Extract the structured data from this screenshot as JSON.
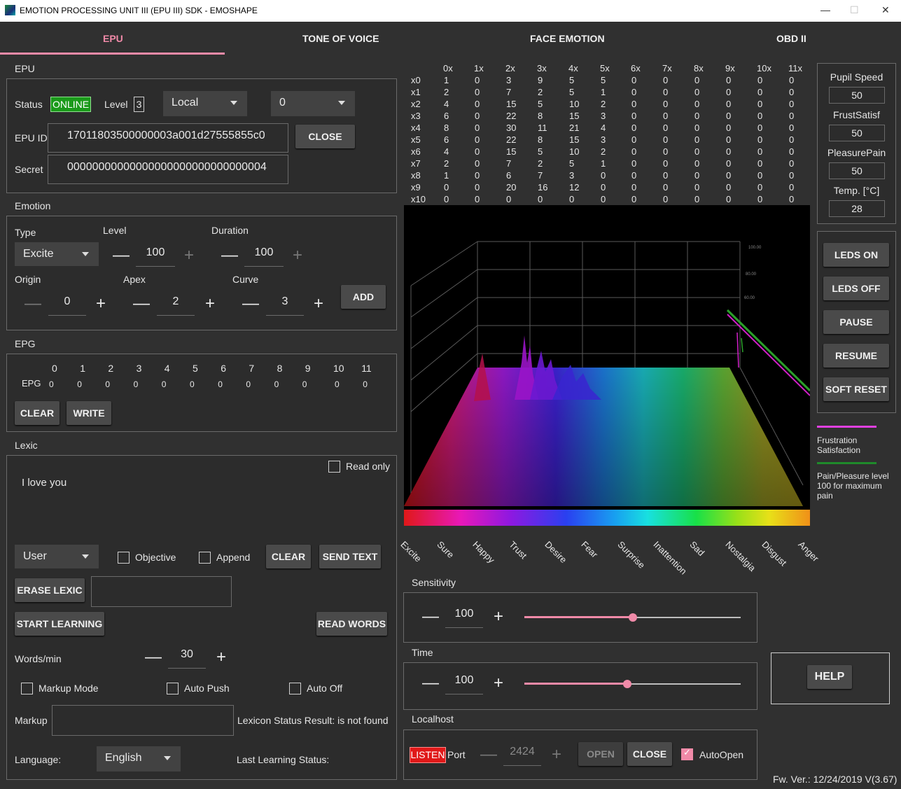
{
  "window": {
    "title": "EMOTION PROCESSING UNIT III (EPU III) SDK - EMOSHAPE",
    "min": "—",
    "max": "☐",
    "close": "✕"
  },
  "tabs": [
    "EPU",
    "TONE OF VOICE",
    "FACE EMOTION",
    "OBD II"
  ],
  "epu": {
    "section": "EPU",
    "status_label": "Status",
    "status_value": "ONLINE",
    "level_label": "Level",
    "level_value": "3",
    "mode": "Local",
    "channel": "0",
    "id_label": "EPU ID",
    "id_value": "17011803500000003a001d27555855c0",
    "close_label": "CLOSE",
    "secret_label": "Secret",
    "secret_value": "00000000000000000000000000000004"
  },
  "emotion": {
    "section": "Emotion",
    "type_label": "Type",
    "type_value": "Excite",
    "level_label": "Level",
    "level_value": "100",
    "duration_label": "Duration",
    "duration_value": "100",
    "origin_label": "Origin",
    "origin_value": "0",
    "apex_label": "Apex",
    "apex_value": "2",
    "curve_label": "Curve",
    "curve_value": "3",
    "add_label": "ADD",
    "minus": "—",
    "plus": "+"
  },
  "epg": {
    "section": "EPG",
    "row_label": "EPG",
    "headers": [
      "0",
      "1",
      "2",
      "3",
      "4",
      "5",
      "6",
      "7",
      "8",
      "9",
      "10",
      "11"
    ],
    "values": [
      "0",
      "0",
      "0",
      "0",
      "0",
      "0",
      "0",
      "0",
      "0",
      "0",
      "0",
      "0"
    ],
    "clear_label": "CLEAR",
    "write_label": "WRITE"
  },
  "lexic": {
    "section": "Lexic",
    "readonly_label": "Read only",
    "text": "I love you",
    "user_value": "User",
    "objective_label": "Objective",
    "append_label": "Append",
    "clear_label": "CLEAR",
    "send_label": "SEND TEXT",
    "erase_label": "ERASE LEXIC",
    "learn_label": "START LEARNING",
    "read_label": "READ WORDS",
    "wpm_label": "Words/min",
    "wpm_value": "30",
    "markup_mode_label": "Markup Mode",
    "auto_push_label": "Auto Push",
    "auto_off_label": "Auto Off",
    "markup_label": "Markup",
    "lexicon_status": "Lexicon Status Result: is not found",
    "language_label": "Language:",
    "language_value": "English",
    "last_status": "Last Learning Status:"
  },
  "matrix": {
    "cols": [
      "0x",
      "1x",
      "2x",
      "3x",
      "4x",
      "5x",
      "6x",
      "7x",
      "8x",
      "9x",
      "10x",
      "11x"
    ],
    "rows": [
      {
        "label": "x0",
        "values": [
          "1",
          "0",
          "3",
          "9",
          "5",
          "5",
          "0",
          "0",
          "0",
          "0",
          "0",
          "0"
        ]
      },
      {
        "label": "x1",
        "values": [
          "2",
          "0",
          "7",
          "2",
          "5",
          "1",
          "0",
          "0",
          "0",
          "0",
          "0",
          "0"
        ]
      },
      {
        "label": "x2",
        "values": [
          "4",
          "0",
          "15",
          "5",
          "10",
          "2",
          "0",
          "0",
          "0",
          "0",
          "0",
          "0"
        ]
      },
      {
        "label": "x3",
        "values": [
          "6",
          "0",
          "22",
          "8",
          "15",
          "3",
          "0",
          "0",
          "0",
          "0",
          "0",
          "0"
        ]
      },
      {
        "label": "x4",
        "values": [
          "8",
          "0",
          "30",
          "11",
          "21",
          "4",
          "0",
          "0",
          "0",
          "0",
          "0",
          "0"
        ]
      },
      {
        "label": "x5",
        "values": [
          "6",
          "0",
          "22",
          "8",
          "15",
          "3",
          "0",
          "0",
          "0",
          "0",
          "0",
          "0"
        ]
      },
      {
        "label": "x6",
        "values": [
          "4",
          "0",
          "15",
          "5",
          "10",
          "2",
          "0",
          "0",
          "0",
          "0",
          "0",
          "0"
        ]
      },
      {
        "label": "x7",
        "values": [
          "2",
          "0",
          "7",
          "2",
          "5",
          "1",
          "0",
          "0",
          "0",
          "0",
          "0",
          "0"
        ]
      },
      {
        "label": "x8",
        "values": [
          "1",
          "0",
          "6",
          "7",
          "3",
          "0",
          "0",
          "0",
          "0",
          "0",
          "0",
          "0"
        ]
      },
      {
        "label": "x9",
        "values": [
          "0",
          "0",
          "20",
          "16",
          "12",
          "0",
          "0",
          "0",
          "0",
          "0",
          "0",
          "0"
        ]
      },
      {
        "label": "x10",
        "values": [
          "0",
          "0",
          "0",
          "0",
          "0",
          "0",
          "0",
          "0",
          "0",
          "0",
          "0",
          "0"
        ]
      }
    ]
  },
  "emotion_axis": [
    "Excite",
    "Sure",
    "Happy",
    "Trust",
    "Desire",
    "Fear",
    "Surprise",
    "Inattention",
    "Sad",
    "Nostalgia",
    "Disgust",
    "Anger"
  ],
  "plot_ticks": [
    "100.00",
    "80.00",
    "60.00"
  ],
  "sensitivity": {
    "section": "Sensitivity",
    "value": "100",
    "fraction": 0.5
  },
  "time": {
    "section": "Time",
    "value": "100",
    "fraction": 0.475
  },
  "localhost": {
    "section": "Localhost",
    "listen_label": "LISTEN",
    "port_label": "Port",
    "port_value": "2424",
    "open_label": "OPEN",
    "close_label": "CLOSE",
    "autoopen_label": "AutoOpen"
  },
  "state": {
    "pupil_label": "Pupil Speed",
    "pupil_value": "50",
    "frust_label": "FrustSatisf",
    "frust_value": "50",
    "pleasure_label": "PleasurePain",
    "pleasure_value": "50",
    "temp_label": "Temp. [°C]",
    "temp_value": "28"
  },
  "controls": [
    "LEDS ON",
    "LEDS OFF",
    "PAUSE",
    "RESUME",
    "SOFT RESET"
  ],
  "legend": {
    "frust_text": "Frustration Satisfaction",
    "frust_color": "#e040e0",
    "pain_text": "Pain/Pleasure level 100 for maximum pain",
    "pain_color": "#1f8a2a"
  },
  "help_label": "HELP",
  "firmware": "Fw. Ver.: 12/24/2019 V(3.67)",
  "colors": {
    "accent": "#f08aa8",
    "online": "#1a9a1a",
    "listen": "#e01818"
  }
}
